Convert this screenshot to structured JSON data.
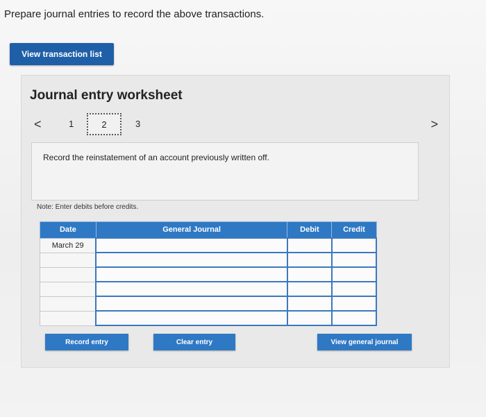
{
  "instruction": "Prepare journal entries to record the above transactions.",
  "view_transaction_list": "View transaction list",
  "worksheet": {
    "title": "Journal entry worksheet",
    "pager": {
      "prev": "<",
      "next": ">",
      "pages": [
        "1",
        "2",
        "3"
      ],
      "current": "2"
    },
    "record_text": "Record the reinstatement of an account previously written off.",
    "note": "Note: Enter debits before credits."
  },
  "table": {
    "headers": {
      "date": "Date",
      "general_journal": "General Journal",
      "debit": "Debit",
      "credit": "Credit"
    },
    "rows": [
      {
        "date": "March 29",
        "account": "",
        "debit": "",
        "credit": ""
      },
      {
        "date": "",
        "account": "",
        "debit": "",
        "credit": ""
      },
      {
        "date": "",
        "account": "",
        "debit": "",
        "credit": ""
      },
      {
        "date": "",
        "account": "",
        "debit": "",
        "credit": ""
      },
      {
        "date": "",
        "account": "",
        "debit": "",
        "credit": ""
      },
      {
        "date": "",
        "account": "",
        "debit": "",
        "credit": ""
      }
    ]
  },
  "buttons": {
    "record_entry": "Record entry",
    "clear_entry": "Clear entry",
    "view_general_journal": "View general journal"
  },
  "colors": {
    "primary_button": "#1f5fa8",
    "table_header": "#2f78c4"
  }
}
